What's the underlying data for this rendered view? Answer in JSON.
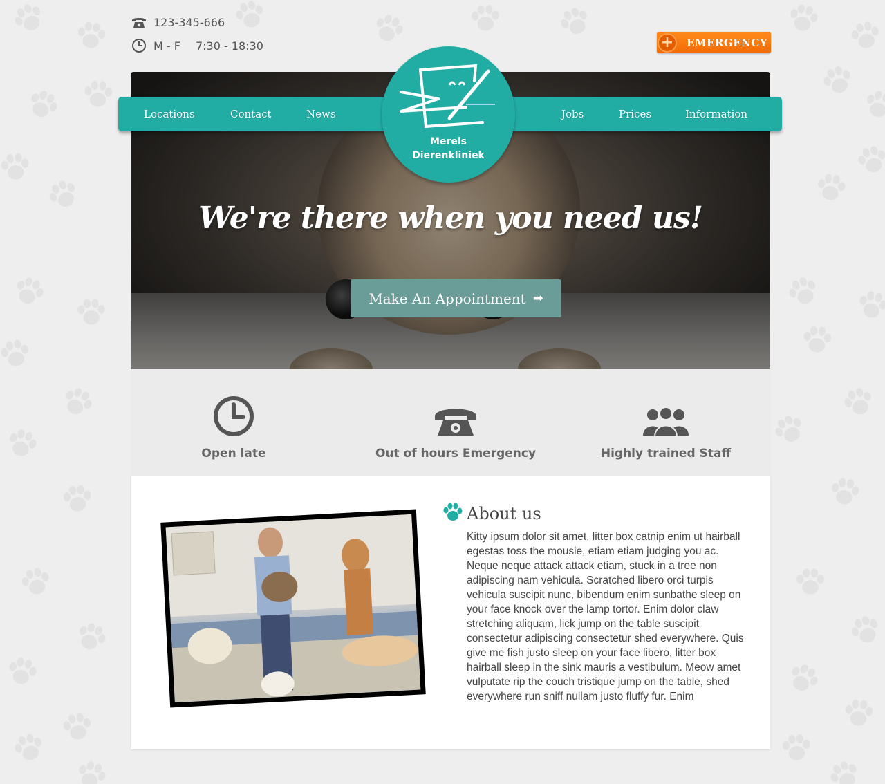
{
  "header": {
    "phone": "123-345-666",
    "hours_days": "M - F",
    "hours_time": "7:30 - 18:30",
    "emergency_label": "EMERGENCY"
  },
  "nav": {
    "left": [
      "Locations",
      "Contact",
      "News"
    ],
    "right": [
      "Jobs",
      "Prices",
      "Information"
    ]
  },
  "logo": {
    "line1": "Merels",
    "line2": "Dierenkliniek"
  },
  "hero": {
    "tagline": "We're there when you need us!",
    "button_label": "Make An Appointment"
  },
  "features": [
    {
      "label": "Open late",
      "icon": "clock-icon"
    },
    {
      "label": "Out of hours Emergency",
      "icon": "telephone-icon"
    },
    {
      "label": "Highly trained Staff",
      "icon": "people-icon"
    }
  ],
  "about": {
    "title": "About us",
    "body": "Kitty ipsum dolor sit amet, litter box catnip enim ut hairball egestas toss the mousie, etiam etiam judging you ac. Neque neque attack attack etiam, stuck in a tree non adipiscing nam vehicula. Scratched libero orci turpis vehicula suscipit nunc, bibendum enim sunbathe sleep on your face knock over the lamp tortor. Enim dolor claw stretching aliquam, lick jump on the table suscipit consectetur adipiscing consectetur shed everywhere. Quis give me fish justo sleep on your face libero, litter box hairball sleep in the sink mauris a vestibulum. Meow amet vulputate rip the couch tristique jump on the table, shed everywhere run sniff nullam justo fluffy fur. Enim"
  },
  "colors": {
    "accent": "#22ada4",
    "button": "#6a9c98",
    "emergency": "#f57a10",
    "background": "#eeeeee"
  }
}
